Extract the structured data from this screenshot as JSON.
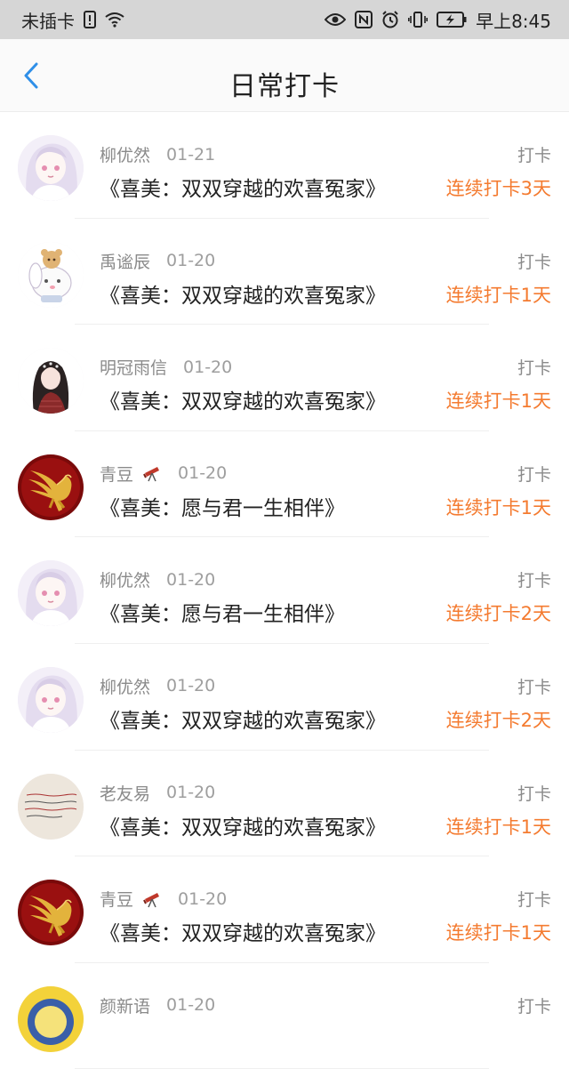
{
  "status_bar": {
    "carrier": "未插卡",
    "time": "早上8:45",
    "icons": [
      "sim-alert-icon",
      "wifi-icon",
      "eye-icon",
      "nfc-icon",
      "alarm-icon",
      "vibrate-icon",
      "battery-icon"
    ]
  },
  "nav": {
    "back_icon": "chevron-left-icon",
    "title": "日常打卡"
  },
  "colors": {
    "accent_back": "#2f8fe8",
    "streak": "#f47b30",
    "text_primary": "#222222",
    "text_secondary": "#8a8a8a"
  },
  "checkins": [
    {
      "user": "柳优然",
      "date": "01-21",
      "book": "《喜美：双双穿越的欢喜冤家》",
      "action": "打卡",
      "streak": "连续打卡3天",
      "avatar": "anime-girl-avatar",
      "emoji": ""
    },
    {
      "user": "禹谧辰",
      "date": "01-20",
      "book": "《喜美：双双穿越的欢喜冤家》",
      "action": "打卡",
      "streak": "连续打卡1天",
      "avatar": "cartoon-bunny-bear-avatar",
      "emoji": ""
    },
    {
      "user": "明冠雨信",
      "date": "01-20",
      "book": "《喜美：双双穿越的欢喜冤家》",
      "action": "打卡",
      "streak": "连续打卡1天",
      "avatar": "girl-dark-hair-avatar",
      "emoji": ""
    },
    {
      "user": "青豆",
      "date": "01-20",
      "book": "《喜美：愿与君一生相伴》",
      "action": "打卡",
      "streak": "连续打卡1天",
      "avatar": "golden-pegasus-avatar",
      "emoji": "telescope-icon"
    },
    {
      "user": "柳优然",
      "date": "01-20",
      "book": "《喜美：愿与君一生相伴》",
      "action": "打卡",
      "streak": "连续打卡2天",
      "avatar": "anime-girl-avatar",
      "emoji": ""
    },
    {
      "user": "柳优然",
      "date": "01-20",
      "book": "《喜美：双双穿越的欢喜冤家》",
      "action": "打卡",
      "streak": "连续打卡2天",
      "avatar": "anime-girl-avatar",
      "emoji": ""
    },
    {
      "user": "老友易",
      "date": "01-20",
      "book": "《喜美：双双穿越的欢喜冤家》",
      "action": "打卡",
      "streak": "连续打卡1天",
      "avatar": "handwritten-note-avatar",
      "emoji": ""
    },
    {
      "user": "青豆",
      "date": "01-20",
      "book": "《喜美：双双穿越的欢喜冤家》",
      "action": "打卡",
      "streak": "连续打卡1天",
      "avatar": "golden-pegasus-avatar",
      "emoji": "telescope-icon"
    },
    {
      "user": "颜新语",
      "date": "01-20",
      "book": "",
      "action": "打卡",
      "streak": "",
      "avatar": "yellow-circle-avatar",
      "emoji": ""
    }
  ]
}
